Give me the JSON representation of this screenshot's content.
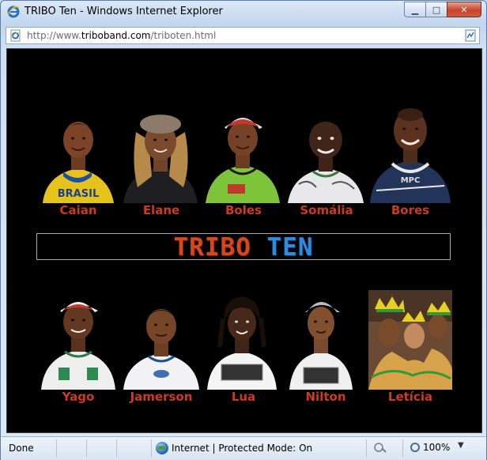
{
  "window": {
    "title": "TRIBO Ten - Windows Internet Explorer",
    "minimize_glyph": "▁",
    "maximize_glyph": "□",
    "close_glyph": "✕"
  },
  "address": {
    "prefix": "http://www.",
    "domain": "triboband.com",
    "path": "/triboten.html"
  },
  "page": {
    "banner_part1": "TRIBO ",
    "banner_part2": "TEN",
    "top_row": [
      {
        "name": "Caian"
      },
      {
        "name": "Elane"
      },
      {
        "name": "Boles"
      },
      {
        "name": "Somália"
      },
      {
        "name": "Bores"
      }
    ],
    "bottom_row": [
      {
        "name": "Yago"
      },
      {
        "name": "Jamerson"
      },
      {
        "name": "Lua"
      },
      {
        "name": "Nilton"
      },
      {
        "name": "Letícia"
      }
    ],
    "shirt_text": {
      "caian": "BRASIL",
      "bores": "MPC"
    },
    "name_color": "#cc3a1f",
    "banner_colors": {
      "tribo": "#d7471c",
      "ten": "#2d8be0"
    }
  },
  "status": {
    "left": "Done",
    "zone": "Internet | Protected Mode: On",
    "zoom": "100%",
    "caret": "▼"
  }
}
